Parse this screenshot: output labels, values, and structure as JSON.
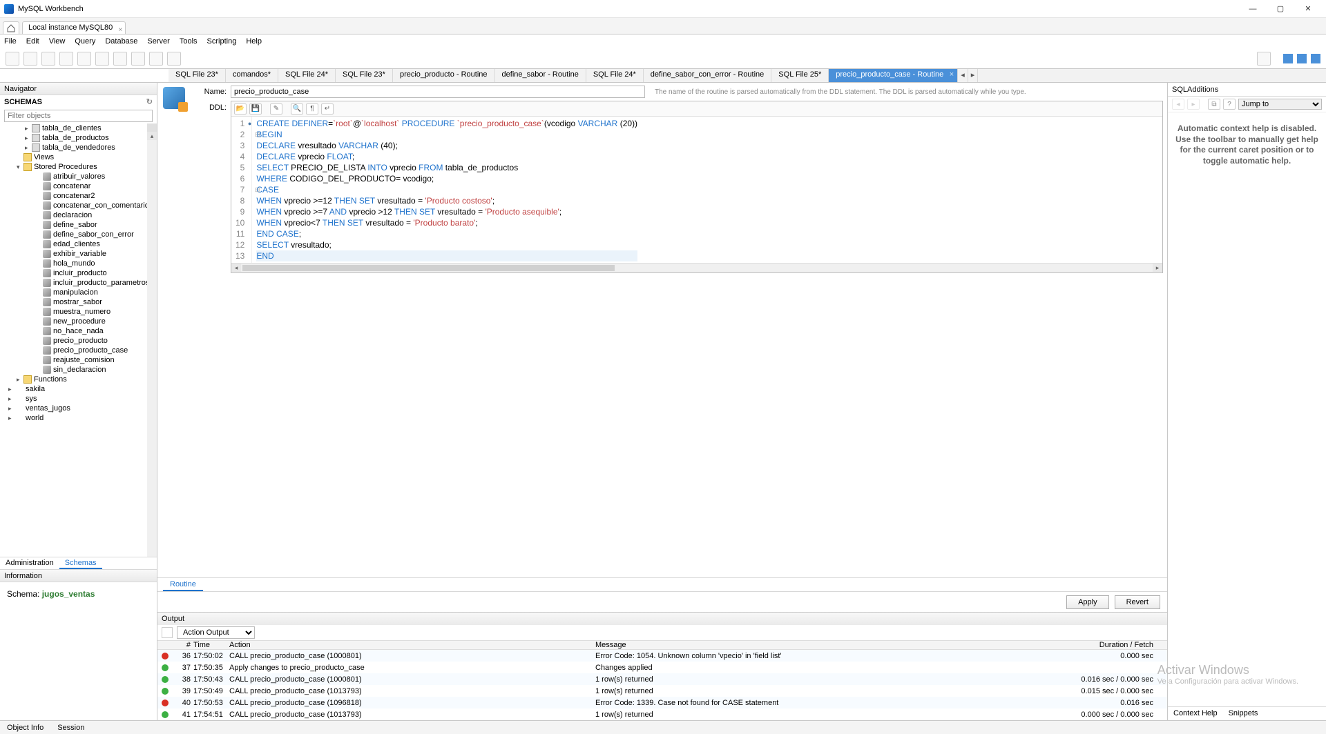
{
  "app": {
    "title": "MySQL Workbench"
  },
  "connection_tab": "Local instance MySQL80",
  "menu": [
    "File",
    "Edit",
    "View",
    "Query",
    "Database",
    "Server",
    "Tools",
    "Scripting",
    "Help"
  ],
  "navigator": {
    "title": "Navigator",
    "section": "SCHEMAS",
    "filter_placeholder": "Filter objects",
    "tables": [
      "tabla_de_clientes",
      "tabla_de_productos",
      "tabla_de_vendedores"
    ],
    "views_label": "Views",
    "sp_label": "Stored Procedures",
    "procedures": [
      "atribuir_valores",
      "concatenar",
      "concatenar2",
      "concatenar_con_comentarios",
      "declaracion",
      "define_sabor",
      "define_sabor_con_error",
      "edad_clientes",
      "exhibir_variable",
      "hola_mundo",
      "incluir_producto",
      "incluir_producto_parametros",
      "manipulacion",
      "mostrar_sabor",
      "muestra_numero",
      "new_procedure",
      "no_hace_nada",
      "precio_producto",
      "precio_producto_case",
      "reajuste_comision",
      "sin_declaracion"
    ],
    "functions_label": "Functions",
    "schemas": [
      "sakila",
      "sys",
      "ventas_jugos",
      "world"
    ],
    "tabs": {
      "admin": "Administration",
      "schemas": "Schemas"
    },
    "info_title": "Information",
    "schema_label": "Schema:",
    "schema_name": "jugos_ventas",
    "footer_tabs": {
      "object": "Object Info",
      "session": "Session"
    }
  },
  "editor_tabs": [
    "SQL File 23*",
    "comandos*",
    "SQL File 24*",
    "SQL File 23*",
    "precio_producto - Routine",
    "define_sabor - Routine",
    "SQL File 24*",
    "define_sabor_con_error - Routine",
    "SQL File 25*",
    "precio_producto_case - Routine"
  ],
  "routine": {
    "name_label": "Name:",
    "name_value": "precio_producto_case",
    "ddl_label": "DDL:",
    "hint": "The name of the routine is parsed automatically from the DDL statement. The DDL is parsed automatically while you type.",
    "bottom_tab": "Routine",
    "apply": "Apply",
    "revert": "Revert"
  },
  "code_lines": [
    {
      "n": 1,
      "dot": true,
      "html": "<span class='kw'>CREATE</span> <span class='kw'>DEFINER</span>=<span class='id2'>`root`</span>@<span class='id2'>`localhost`</span> <span class='kw'>PROCEDURE</span> <span class='id2'>`precio_producto_case`</span>(vcodigo <span class='ty'>VARCHAR</span> (<span class='num'>20</span>))"
    },
    {
      "n": 2,
      "fold": true,
      "html": "<span class='kw'>BEGIN</span>"
    },
    {
      "n": 3,
      "html": "<span class='kw'>DECLARE</span> vresultado <span class='ty'>VARCHAR</span> (<span class='num'>40</span>);"
    },
    {
      "n": 4,
      "html": "<span class='kw'>DECLARE</span> vprecio <span class='ty'>FLOAT</span>;"
    },
    {
      "n": 5,
      "html": "<span class='kw'>SELECT</span> PRECIO_DE_LISTA <span class='kw'>INTO</span> vprecio <span class='kw'>FROM</span> tabla_de_productos"
    },
    {
      "n": 6,
      "html": "<span class='kw'>WHERE</span> CODIGO_DEL_PRODUCTO= vcodigo;"
    },
    {
      "n": 7,
      "fold": true,
      "html": "<span class='kw'>CASE</span>"
    },
    {
      "n": 8,
      "html": "<span class='kw'>WHEN</span> vprecio &gt;=<span class='num'>12</span> <span class='kw'>THEN</span> <span class='kw'>SET</span> vresultado = <span class='str'>'Producto costoso'</span>;"
    },
    {
      "n": 9,
      "html": "<span class='kw'>WHEN</span> vprecio &gt;=<span class='num'>7</span> <span class='kw'>AND</span> vprecio &gt;<span class='num'>12</span> <span class='kw'>THEN</span> <span class='kw'>SET</span> vresultado = <span class='str'>'Producto asequible'</span>;"
    },
    {
      "n": 10,
      "html": "<span class='kw'>WHEN</span> vprecio&lt;<span class='num'>7</span> <span class='kw'>THEN</span> <span class='kw'>SET</span> vresultado = <span class='str'>'Producto barato'</span>;"
    },
    {
      "n": 11,
      "html": "<span class='kw'>END</span> <span class='kw'>CASE</span>;"
    },
    {
      "n": 12,
      "html": "<span class='kw'>SELECT</span> vresultado;"
    },
    {
      "n": 13,
      "hl": true,
      "html": "<span class='kw'>END</span>"
    }
  ],
  "output": {
    "title": "Output",
    "dropdown": "Action Output",
    "headers": {
      "num": "#",
      "time": "Time",
      "action": "Action",
      "msg": "Message",
      "dur": "Duration / Fetch"
    },
    "rows": [
      {
        "status": "err",
        "num": 36,
        "time": "17:50:02",
        "action": "CALL precio_producto_case (1000801)",
        "msg": "Error Code: 1054. Unknown column 'vpecio' in 'field list'",
        "dur": "0.000 sec"
      },
      {
        "status": "ok",
        "num": 37,
        "time": "17:50:35",
        "action": "Apply changes to precio_producto_case",
        "msg": "Changes applied",
        "dur": ""
      },
      {
        "status": "ok",
        "num": 38,
        "time": "17:50:43",
        "action": "CALL precio_producto_case (1000801)",
        "msg": "1 row(s) returned",
        "dur": "0.016 sec / 0.000 sec"
      },
      {
        "status": "ok",
        "num": 39,
        "time": "17:50:49",
        "action": "CALL precio_producto_case (1013793)",
        "msg": "1 row(s) returned",
        "dur": "0.015 sec / 0.000 sec"
      },
      {
        "status": "err",
        "num": 40,
        "time": "17:50:53",
        "action": "CALL precio_producto_case (1096818)",
        "msg": "Error Code: 1339. Case not found for CASE statement",
        "dur": "0.016 sec"
      },
      {
        "status": "ok",
        "num": 41,
        "time": "17:54:51",
        "action": "CALL precio_producto_case (1013793)",
        "msg": "1 row(s) returned",
        "dur": "0.000 sec / 0.000 sec"
      }
    ]
  },
  "sql_additions": {
    "title": "SQLAdditions",
    "jump": "Jump to",
    "help": "Automatic context help is disabled. Use the toolbar to manually get help for the current caret position or to toggle automatic help.",
    "tabs": {
      "context": "Context Help",
      "snippets": "Snippets"
    }
  },
  "watermark": {
    "line1": "Activar Windows",
    "line2": "Ve a Configuración para activar Windows."
  }
}
